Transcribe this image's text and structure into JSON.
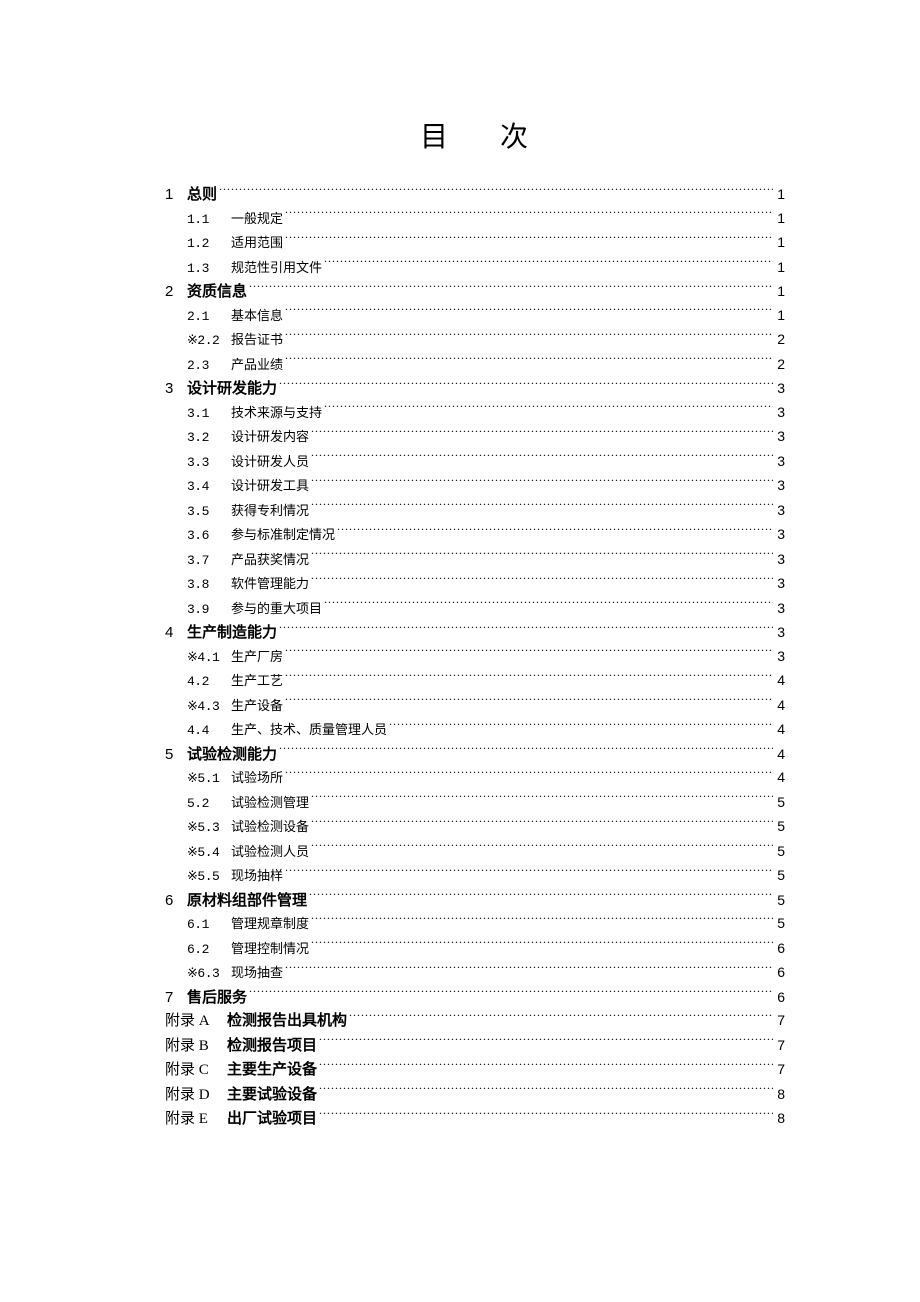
{
  "title_char1": "目",
  "title_char2": "次",
  "entries": [
    {
      "level": "level1",
      "num": "1",
      "label": "总则",
      "page": "1"
    },
    {
      "level": "level2",
      "num": "1.1",
      "label": "一般规定",
      "page": "1"
    },
    {
      "level": "level2",
      "num": "1.2",
      "label": "适用范围",
      "page": "1"
    },
    {
      "level": "level2",
      "num": "1.3",
      "label": "规范性引用文件",
      "page": "1"
    },
    {
      "level": "level1",
      "num": "2",
      "label": "资质信息",
      "page": "1"
    },
    {
      "level": "level2",
      "num": "2.1",
      "label": "基本信息",
      "page": "1"
    },
    {
      "level": "level2",
      "num": "※2.2",
      "label": "报告证书",
      "page": "2"
    },
    {
      "level": "level2",
      "num": "2.3",
      "label": "产品业绩",
      "page": "2"
    },
    {
      "level": "level1",
      "num": "3",
      "label": "设计研发能力",
      "page": "3"
    },
    {
      "level": "level2",
      "num": "3.1",
      "label": "技术来源与支持",
      "page": "3"
    },
    {
      "level": "level2",
      "num": "3.2",
      "label": "设计研发内容",
      "page": "3"
    },
    {
      "level": "level2",
      "num": "3.3",
      "label": "设计研发人员",
      "page": "3"
    },
    {
      "level": "level2",
      "num": "3.4",
      "label": "设计研发工具",
      "page": "3"
    },
    {
      "level": "level2",
      "num": "3.5",
      "label": "获得专利情况",
      "page": "3"
    },
    {
      "level": "level2",
      "num": "3.6",
      "label": "参与标准制定情况",
      "page": "3"
    },
    {
      "level": "level2",
      "num": "3.7",
      "label": "产品获奖情况",
      "page": "3"
    },
    {
      "level": "level2",
      "num": "3.8",
      "label": "软件管理能力",
      "page": "3"
    },
    {
      "level": "level2",
      "num": "3.9",
      "label": "参与的重大项目",
      "page": "3"
    },
    {
      "level": "level1",
      "num": "4",
      "label": "生产制造能力",
      "page": "3"
    },
    {
      "level": "level2",
      "num": "※4.1",
      "label": "生产厂房",
      "page": "3"
    },
    {
      "level": "level2",
      "num": "4.2",
      "label": "生产工艺",
      "page": "4"
    },
    {
      "level": "level2",
      "num": "※4.3",
      "label": "生产设备",
      "page": "4"
    },
    {
      "level": "level2",
      "num": "4.4",
      "label": "生产、技术、质量管理人员",
      "page": "4"
    },
    {
      "level": "level1",
      "num": "5",
      "label": "试验检测能力",
      "page": "4"
    },
    {
      "level": "level2",
      "num": "※5.1",
      "label": "试验场所",
      "page": "4"
    },
    {
      "level": "level2",
      "num": "5.2",
      "label": "试验检测管理",
      "page": "5"
    },
    {
      "level": "level2",
      "num": "※5.3",
      "label": "试验检测设备",
      "page": "5"
    },
    {
      "level": "level2",
      "num": "※5.4",
      "label": "试验检测人员",
      "page": "5"
    },
    {
      "level": "level2",
      "num": "※5.5",
      "label": "现场抽样",
      "page": "5"
    },
    {
      "level": "level1",
      "num": "6",
      "label": "原材料组部件管理",
      "page": "5"
    },
    {
      "level": "level2",
      "num": "6.1",
      "label": "管理规章制度",
      "page": "5"
    },
    {
      "level": "level2",
      "num": "6.2",
      "label": "管理控制情况",
      "page": "6"
    },
    {
      "level": "level2",
      "num": "※6.3",
      "label": "现场抽查",
      "page": "6"
    },
    {
      "level": "level1",
      "num": "7",
      "label": "售后服务",
      "page": "6"
    },
    {
      "level": "appendix",
      "num": "附录 A",
      "label": "检测报告出具机构",
      "page": "7"
    },
    {
      "level": "appendix",
      "num": "附录 B",
      "label": "检测报告项目",
      "page": "7"
    },
    {
      "level": "appendix",
      "num": "附录 C",
      "label": "主要生产设备",
      "page": "7"
    },
    {
      "level": "appendix",
      "num": "附录 D",
      "label": "主要试验设备",
      "page": "8"
    },
    {
      "level": "appendix",
      "num": "附录 E",
      "label": "出厂试验项目",
      "page": "8"
    }
  ]
}
